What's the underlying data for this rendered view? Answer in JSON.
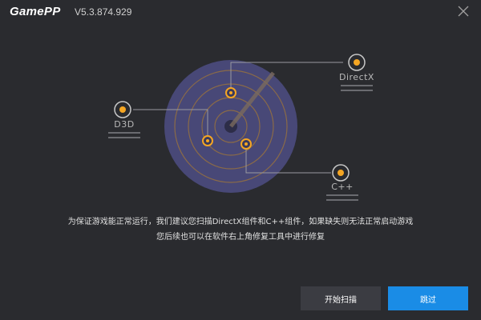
{
  "app": {
    "name": "GamePP",
    "version": "V5.3.874.929"
  },
  "nodes": {
    "d3d": "D3D",
    "directx": "DirectX",
    "cpp": "C++"
  },
  "message": {
    "line1": "为保证游戏能正常运行，我们建议您扫描DirectX组件和C++组件，如果缺失则无法正常启动游戏",
    "line2": "您后续也可以在软件右上角修复工具中进行修复"
  },
  "buttons": {
    "scan": "开始扫描",
    "skip": "跳过"
  },
  "colors": {
    "background": "#2a2b2f",
    "accent": "#f5a623",
    "primary_button": "#1a8ce6",
    "secondary_button": "#3b3c42",
    "radar_fill": "#4a4a7a"
  },
  "icons": {
    "close": "close-icon"
  }
}
